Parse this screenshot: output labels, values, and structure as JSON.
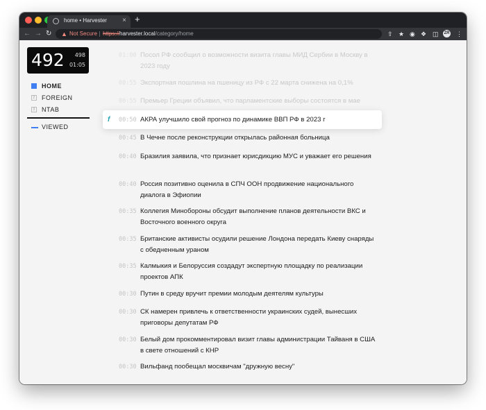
{
  "browser": {
    "tab_title": "home • Harvester",
    "tab_close": "×",
    "new_tab": "+",
    "not_secure": "Not Secure",
    "url_scheme": "https://",
    "url_host": "harvester.local",
    "url_path": "/category/home",
    "avatar": "ZR"
  },
  "counter": {
    "main": "492",
    "total": "498",
    "time": "01:05"
  },
  "sidebar": {
    "items": [
      {
        "label": "HOME",
        "key": "",
        "active": true
      },
      {
        "label": "FOREIGN",
        "key": "2",
        "active": false
      },
      {
        "label": "NTAB",
        "key": "3",
        "active": false
      }
    ],
    "viewed_label": "VIEWED"
  },
  "news": [
    {
      "time": "01:00",
      "headline": "Посол РФ сообщил о возможности визита главы МИД Сербии в Москву в 2023 году",
      "state": "faded"
    },
    {
      "time": "00:55",
      "headline": "Экспортная пошлина на пшеницу из РФ с 22 марта снижена на 0,1%",
      "state": "faded"
    },
    {
      "time": "00:55",
      "headline": "Премьер Греции объявил, что парламентские выборы состоятся в мае",
      "state": "faded"
    },
    {
      "time": "00:50",
      "headline": "АКРА улучшило свой прогноз по динамике ВВП РФ в 2023 г",
      "state": "hovered"
    },
    {
      "time": "00:45",
      "headline": "В Чечне после реконструкции открылась районная больница",
      "state": "normal"
    },
    {
      "time": "00:40",
      "headline": "Бразилия заявила, что признает юрисдикцию МУС и уважает его решения",
      "state": "normal"
    },
    {
      "time": "00:40",
      "headline": "Россия позитивно оценила в СПЧ ООН продвижение национального диалога в Эфиопии",
      "state": "normal"
    },
    {
      "time": "00:35",
      "headline": "Коллегия Минобороны обсудит выполнение планов деятельности ВКС и Восточного военного округа",
      "state": "normal"
    },
    {
      "time": "00:35",
      "headline": "Британские активисты осудили решение Лондона передать Киеву снаряды с обедненным ураном",
      "state": "normal"
    },
    {
      "time": "00:35",
      "headline": "Калмыкия и Белоруссия создадут экспертную площадку по реализации проектов АПК",
      "state": "normal"
    },
    {
      "time": "00:30",
      "headline": "Путин в среду вручит премии молодым деятелям культуры",
      "state": "normal"
    },
    {
      "time": "00:30",
      "headline": "СК намерен привлечь к ответственности украинских судей, вынесших приговоры депутатам РФ",
      "state": "normal"
    },
    {
      "time": "00:30",
      "headline": "Белый дом прокомментировал визит главы администрации Тайваня в США в свете отношений с КНР",
      "state": "normal"
    },
    {
      "time": "00:30",
      "headline": "Вильфанд пообещал москвичам \"дружную весну\"",
      "state": "normal"
    }
  ]
}
